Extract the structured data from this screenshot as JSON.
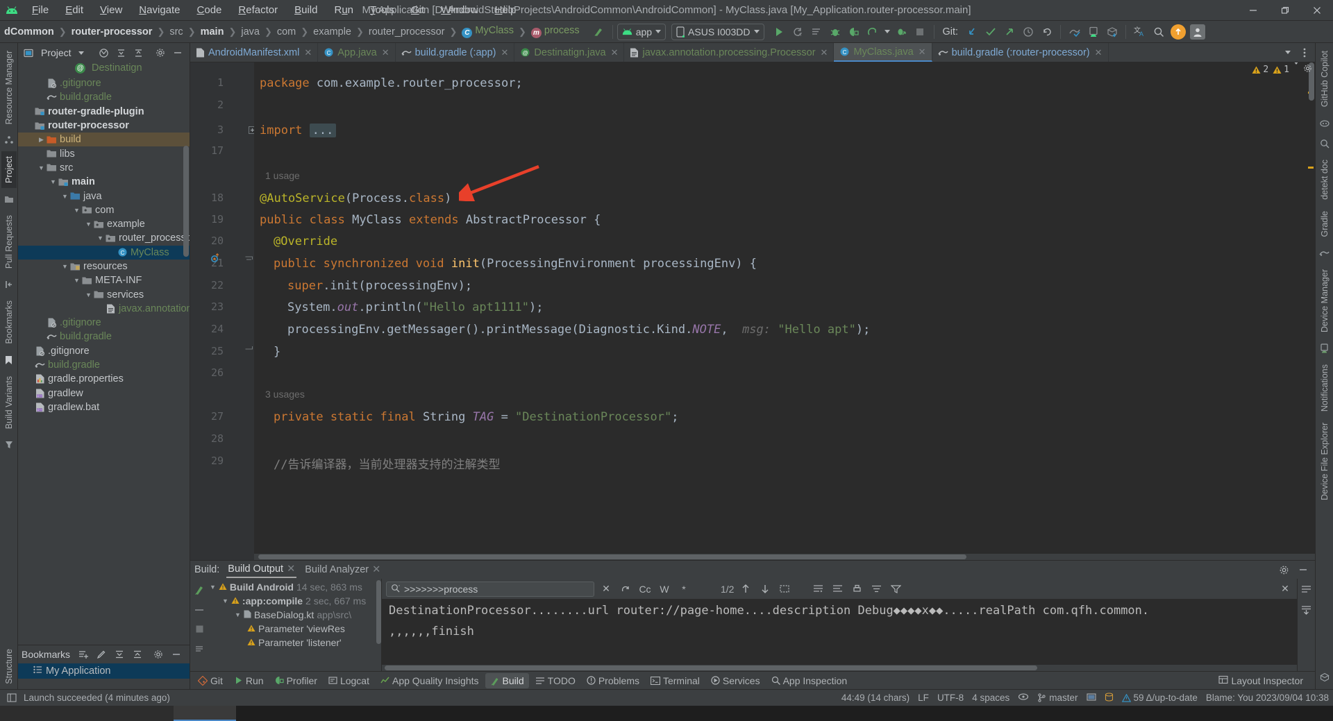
{
  "window": {
    "title": "My Application [D:\\AndroidStudioProjects\\AndroidCommon\\AndroidCommon] - MyClass.java [My_Application.router-processor.main]",
    "minimize": "—",
    "restore": "❐",
    "close": "✕"
  },
  "menu": [
    "File",
    "Edit",
    "View",
    "Navigate",
    "Code",
    "Refactor",
    "Build",
    "Run",
    "Tools",
    "Git",
    "Window",
    "Help"
  ],
  "breadcrumbs": [
    {
      "label": "dCommon",
      "style": "bold"
    },
    {
      "label": "router-processor",
      "style": "bold"
    },
    {
      "label": "src",
      "style": "normal"
    },
    {
      "label": "main",
      "style": "bold"
    },
    {
      "label": "java",
      "style": "normal"
    },
    {
      "label": "com",
      "style": "normal"
    },
    {
      "label": "example",
      "style": "normal"
    },
    {
      "label": "router_processor",
      "style": "normal"
    },
    {
      "label": "MyClass",
      "style": "green",
      "icon": "c"
    },
    {
      "label": "process",
      "style": "green",
      "icon": "m"
    }
  ],
  "toolbar": {
    "module_selector": "app",
    "device_selector": "ASUS I003DD",
    "git_label": "Git:",
    "run_tooltip": "Run",
    "icons": [
      "run-icon",
      "rerun-icon",
      "apply-changes-icon",
      "debug-icon",
      "profile-icon",
      "attach-debugger-icon",
      "stop-icon",
      "update-project-icon",
      "commit-icon",
      "push-icon",
      "history-icon",
      "rollback-icon",
      "layout-inspector-icon",
      "device-manager-icon",
      "device-explorer-icon",
      "translate-icon",
      "search-icon",
      "update-available-icon",
      "account-icon"
    ]
  },
  "editor_tabs": [
    {
      "label": "AndroidManifest.xml",
      "icon": "xml-file-icon",
      "color": "blue",
      "active": false
    },
    {
      "label": "App.java",
      "icon": "class-icon",
      "color": "green",
      "active": false
    },
    {
      "label": "build.gradle (:app)",
      "icon": "gradle-icon",
      "color": "blue",
      "active": false
    },
    {
      "label": "Destinatign.java",
      "icon": "annotation-icon",
      "color": "green",
      "active": false
    },
    {
      "label": "javax.annotation.processing.Processor",
      "icon": "text-file-icon",
      "color": "green",
      "active": false
    },
    {
      "label": "MyClass.java",
      "icon": "class-icon",
      "color": "green",
      "active": true
    },
    {
      "label": "build.gradle (:router-processor)",
      "icon": "gradle-icon",
      "color": "blue",
      "active": false
    }
  ],
  "project_panel": {
    "title": "Project",
    "floating_label": "Destinatign",
    "tree": [
      {
        "depth": 3,
        "label": ".gitignore",
        "icon": "gitignore-icon",
        "style": "green",
        "arrow": ""
      },
      {
        "depth": 3,
        "label": "build.gradle",
        "icon": "gradle-icon",
        "style": "green",
        "arrow": ""
      },
      {
        "depth": 2,
        "label": "router-gradle-plugin",
        "icon": "module-icon",
        "style": "bold",
        "arrow": ""
      },
      {
        "depth": 2,
        "label": "router-processor",
        "icon": "module-icon",
        "style": "bold",
        "arrow": ""
      },
      {
        "depth": 3,
        "label": "build",
        "icon": "folder-orange-icon",
        "style": "yellowish",
        "arrow": "collapsed",
        "highlight": "build"
      },
      {
        "depth": 3,
        "label": "libs",
        "icon": "folder-icon",
        "style": "white",
        "arrow": ""
      },
      {
        "depth": 3,
        "label": "src",
        "icon": "folder-icon",
        "style": "white",
        "arrow": "expanded"
      },
      {
        "depth": 4,
        "label": "main",
        "icon": "module-icon",
        "style": "bold",
        "arrow": "expanded"
      },
      {
        "depth": 5,
        "label": "java",
        "icon": "folder-blue-icon",
        "style": "white",
        "arrow": "expanded"
      },
      {
        "depth": 6,
        "label": "com",
        "icon": "package-icon",
        "style": "white",
        "arrow": "expanded"
      },
      {
        "depth": 7,
        "label": "example",
        "icon": "package-icon",
        "style": "white",
        "arrow": "expanded"
      },
      {
        "depth": 8,
        "label": "router_processor",
        "icon": "package-icon",
        "style": "white",
        "arrow": "expanded"
      },
      {
        "depth": 9,
        "label": "MyClass",
        "icon": "class-icon",
        "style": "green",
        "arrow": "",
        "highlight": "selected"
      },
      {
        "depth": 5,
        "label": "resources",
        "icon": "resources-icon",
        "style": "white",
        "arrow": "expanded"
      },
      {
        "depth": 6,
        "label": "META-INF",
        "icon": "folder-icon",
        "style": "white",
        "arrow": "expanded"
      },
      {
        "depth": 7,
        "label": "services",
        "icon": "folder-icon",
        "style": "white",
        "arrow": "expanded"
      },
      {
        "depth": 8,
        "label": "javax.annotation.pro",
        "icon": "text-file-icon",
        "style": "green",
        "arrow": ""
      },
      {
        "depth": 3,
        "label": ".gitignore",
        "icon": "gitignore-icon",
        "style": "green",
        "arrow": ""
      },
      {
        "depth": 3,
        "label": "build.gradle",
        "icon": "gradle-icon",
        "style": "green",
        "arrow": ""
      },
      {
        "depth": 2,
        "label": ".gitignore",
        "icon": "gitignore-icon",
        "style": "white",
        "arrow": ""
      },
      {
        "depth": 2,
        "label": "build.gradle",
        "icon": "gradle-icon",
        "style": "green",
        "arrow": ""
      },
      {
        "depth": 2,
        "label": "gradle.properties",
        "icon": "properties-icon",
        "style": "white",
        "arrow": ""
      },
      {
        "depth": 2,
        "label": "gradlew",
        "icon": "gradlew-icon",
        "style": "white",
        "arrow": ""
      },
      {
        "depth": 2,
        "label": "gradlew.bat",
        "icon": "gradlew-icon",
        "style": "white",
        "arrow": ""
      }
    ]
  },
  "bookmarks_panel": {
    "title": "Bookmarks",
    "items": [
      "My Application"
    ]
  },
  "left_strip": [
    "Resource Manager",
    "Project",
    "Pull Requests",
    "Bookmarks",
    "Build Variants",
    "Structure"
  ],
  "right_strip": [
    "Gradle",
    "Device Manager",
    "Notifications",
    "Device File Explorer",
    "detekt doc",
    "GitHub Copilot"
  ],
  "code": {
    "file": "MyClass.java",
    "warnings_count": "2",
    "errors_count": "1",
    "lines": [
      {
        "num": "1",
        "text": "package com.example.router_processor;"
      },
      {
        "num": "2",
        "text": ""
      },
      {
        "num": "3",
        "text": "import ..."
      },
      {
        "num": "17",
        "text": ""
      },
      {
        "num": "",
        "text": "1 usage"
      },
      {
        "num": "18",
        "text": "@AutoService(Process.class)"
      },
      {
        "num": "19",
        "text": "public class MyClass extends AbstractProcessor {"
      },
      {
        "num": "20",
        "text": "    @Override"
      },
      {
        "num": "21",
        "text": "    public synchronized void init(ProcessingEnvironment processingEnv) {"
      },
      {
        "num": "22",
        "text": "        super.init(processingEnv);"
      },
      {
        "num": "23",
        "text": "        System.out.println(\"Hello apt1111\");"
      },
      {
        "num": "24",
        "text": "        processingEnv.getMessager().printMessage(Diagnostic.Kind.NOTE,  msg: \"Hello apt\");"
      },
      {
        "num": "25",
        "text": "    }"
      },
      {
        "num": "26",
        "text": ""
      },
      {
        "num": "",
        "text": "3 usages"
      },
      {
        "num": "27",
        "text": "    private static final String TAG = \"DestinationProcessor\";"
      },
      {
        "num": "28",
        "text": ""
      },
      {
        "num": "29",
        "text": "    //告诉编译器，当前处理器支持的注解类型"
      }
    ]
  },
  "build_panel": {
    "label": "Build:",
    "tabs": [
      {
        "label": "Build Output",
        "active": true
      },
      {
        "label": "Build Analyzer",
        "active": false
      }
    ],
    "tree": [
      {
        "depth": 1,
        "label": "Build Android",
        "time": "14 sec, 863 ms",
        "icon": "warning-icon",
        "bold": true
      },
      {
        "depth": 2,
        "label": ":app:compile",
        "time": "2 sec, 667 ms",
        "icon": "warning-icon",
        "bold": false
      },
      {
        "depth": 3,
        "label": "BaseDialog.kt",
        "time": "app\\src\\",
        "icon": "file-icon",
        "bold": false
      },
      {
        "depth": 4,
        "label": "Parameter 'viewRes",
        "time": "",
        "icon": "warning-icon",
        "bold": false
      },
      {
        "depth": 4,
        "label": "Parameter 'listener'",
        "time": "",
        "icon": "warning-icon",
        "bold": false
      }
    ],
    "search": {
      "value": ">>>>>>>process",
      "match_count": "1/2",
      "options": [
        "Cc",
        "W",
        "*"
      ]
    },
    "console_lines": [
      "DestinationProcessor........url router://page-home....description Debug◆◆◆◆x◆◆.....realPath com.qfh.common.",
      ",,,,,,finish"
    ]
  },
  "bottom_tabs": [
    {
      "label": "Git",
      "icon": "git-icon",
      "active": false
    },
    {
      "label": "Run",
      "icon": "run-icon",
      "active": false
    },
    {
      "label": "Profiler",
      "icon": "profiler-icon",
      "active": false
    },
    {
      "label": "Logcat",
      "icon": "logcat-icon",
      "active": false
    },
    {
      "label": "App Quality Insights",
      "icon": "insights-icon",
      "active": false
    },
    {
      "label": "Build",
      "icon": "build-icon",
      "active": true
    },
    {
      "label": "TODO",
      "icon": "todo-icon",
      "active": false
    },
    {
      "label": "Problems",
      "icon": "problems-icon",
      "active": false
    },
    {
      "label": "Terminal",
      "icon": "terminal-icon",
      "active": false
    },
    {
      "label": "Services",
      "icon": "services-icon",
      "active": false
    },
    {
      "label": "App Inspection",
      "icon": "app-inspection-icon",
      "active": false
    }
  ],
  "bottom_right": {
    "layout_inspector": "Layout Inspector"
  },
  "status_bar": {
    "message": "Launch succeeded (4 minutes ago)",
    "caret": "44:49 (14 chars)",
    "line_sep": "LF",
    "encoding": "UTF-8",
    "indent": "4 spaces",
    "branch": "master",
    "gradle_status": "59 Δ/up-to-date",
    "blame": "Blame: You 2023/09/04 10:38"
  },
  "colors": {
    "accent_blue": "#4a88c7",
    "selection_blue": "#0d3a58",
    "green_text": "#6a8759",
    "orange_kw": "#cc7832",
    "annotation_yellow": "#bbb529",
    "warning_yellow": "#d9a21b",
    "arrow_red": "#e8402a",
    "panel_bg": "#3c3f41",
    "editor_bg": "#2b2b2b"
  }
}
